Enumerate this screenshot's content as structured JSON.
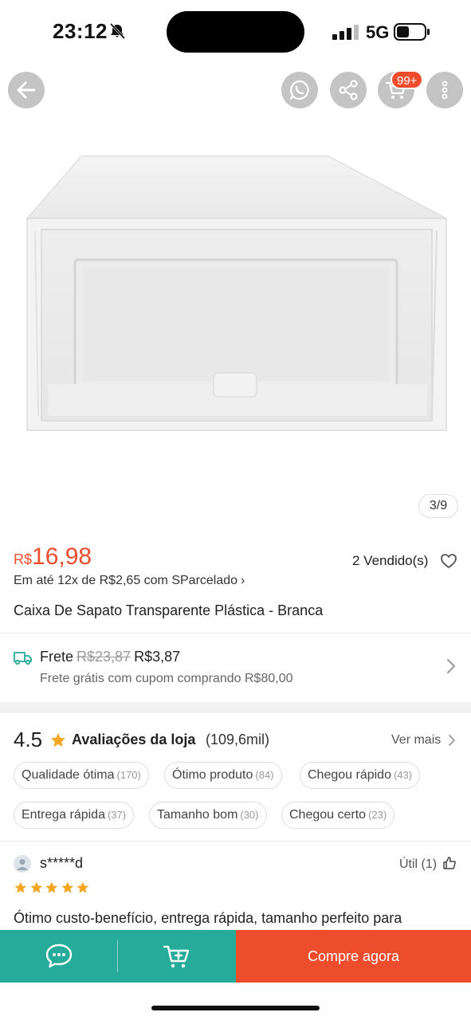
{
  "status_bar": {
    "time": "23:12",
    "network": "5G"
  },
  "header": {
    "cart_badge": "99+",
    "icons": [
      "arrow-left-icon",
      "whatsapp-icon",
      "share-icon",
      "cart-icon",
      "more-vertical-icon"
    ]
  },
  "gallery": {
    "counter": "3/9"
  },
  "product": {
    "currency": "R$",
    "price": "16,98",
    "sold": "2 Vendido(s)",
    "installment": "Em até 12x de R$2,65 com SParcelado",
    "title": "Caixa De Sapato Transparente Plástica - Branca"
  },
  "shipping": {
    "label": "Frete",
    "old_price": "R$23,87",
    "price": "R$3,87",
    "note": "Frete grátis com cupom comprando R$80,00"
  },
  "ratings": {
    "score": "4.5",
    "label": "Avaliações da loja",
    "count": "(109,6mil)",
    "see_more": "Ver mais",
    "tags": [
      {
        "label": "Qualidade ótima",
        "count": "(170)"
      },
      {
        "label": "Ótimo produto",
        "count": "(84)"
      },
      {
        "label": "Chegou rápido",
        "count": "(43)"
      },
      {
        "label": "Entrega rápida",
        "count": "(37)"
      },
      {
        "label": "Tamanho bom",
        "count": "(30)"
      },
      {
        "label": "Chegou certo",
        "count": "(23)"
      }
    ]
  },
  "review": {
    "reviewer": "s*****d",
    "useful": "Útil (1)",
    "stars": 5,
    "text": "Ótimo custo-benefício, entrega rápida, tamanho perfeito para"
  },
  "bottom_bar": {
    "buy_label": "Compre agora"
  },
  "colors": {
    "accent": "#ee4d2d",
    "teal": "#26aa99",
    "star": "#f5a623"
  }
}
